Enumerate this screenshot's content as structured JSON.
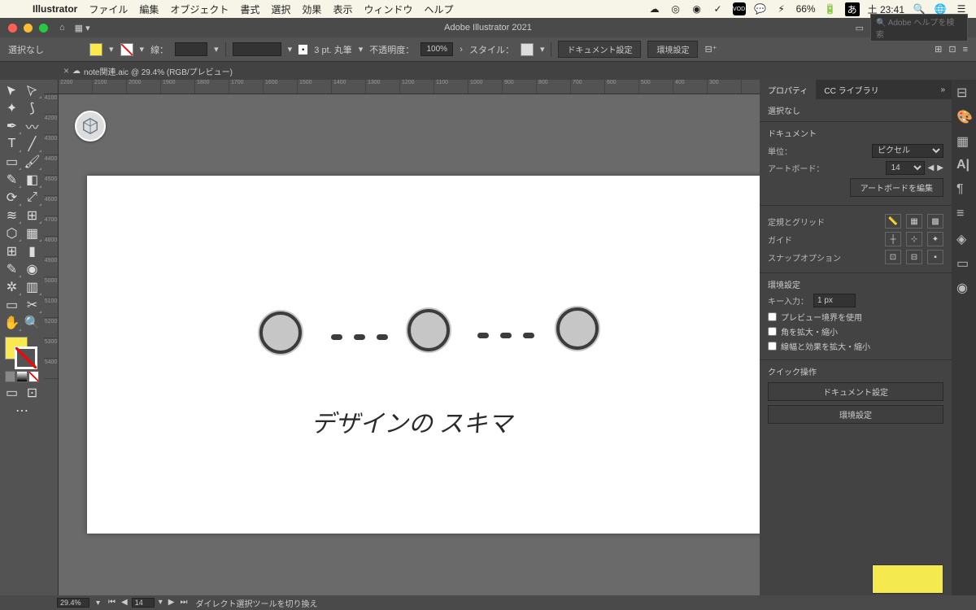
{
  "mac_menu": {
    "app": "Illustrator",
    "items": [
      "ファイル",
      "編集",
      "オブジェクト",
      "書式",
      "選択",
      "効果",
      "表示",
      "ウィンドウ",
      "ヘルプ"
    ],
    "battery": "66%",
    "ime": "あ",
    "clock": "土 23:41"
  },
  "titlebar": {
    "title": "Adobe Illustrator 2021",
    "search_ph": "Adobe ヘルプを検索"
  },
  "controlbar": {
    "selection": "選択なし",
    "fill_color": "#fce94f",
    "stroke_label": "線：",
    "stroke_weight": "",
    "brush": "3 pt. 丸筆",
    "opacity_label": "不透明度：",
    "opacity": "100%",
    "style_label": "スタイル：",
    "doc_setup": "ドキュメント設定",
    "prefs": "環境設定"
  },
  "tab": {
    "name": "note関連.aic @ 29.4% (RGB/プレビュー)"
  },
  "hruler": [
    "2200",
    "2100",
    "2000",
    "1900",
    "1800",
    "1700",
    "1600",
    "1500",
    "1400",
    "1300",
    "1200",
    "1100",
    "1000",
    "900",
    "800",
    "700",
    "600",
    "500",
    "400",
    "300"
  ],
  "vruler": [
    "4100",
    "4200",
    "4300",
    "4400",
    "4500",
    "4600",
    "4700",
    "4800",
    "4900",
    "5000",
    "5100",
    "5200",
    "5300",
    "5400"
  ],
  "panel": {
    "tabs": {
      "properties": "プロパティ",
      "cc": "CC ライブラリ"
    },
    "selection": "選択なし",
    "document": "ドキュメント",
    "units_label": "単位：",
    "units": "ピクセル",
    "artboard_label": "アートボード：",
    "artboard_num": "14",
    "edit_artboards": "アートボードを編集",
    "ruler_grid": "定規とグリッド",
    "guides": "ガイド",
    "snap": "スナップオプション",
    "prefs_heading": "環境設定",
    "key_label": "キー入力：",
    "key_val": "1 px",
    "cb_preview": "プレビュー境界を使用",
    "cb_scale_corners": "角を拡大・縮小",
    "cb_scale_strokes": "線幅と効果を拡大・縮小",
    "quick_label": "クイック操作",
    "doc_setup_btn": "ドキュメント設定",
    "prefs_btn": "環境設定"
  },
  "status": {
    "zoom": "29.4%",
    "artboard": "14",
    "hint": "ダイレクト選択ツールを切り換え"
  },
  "art": {
    "text": "デザインの スキマ"
  }
}
